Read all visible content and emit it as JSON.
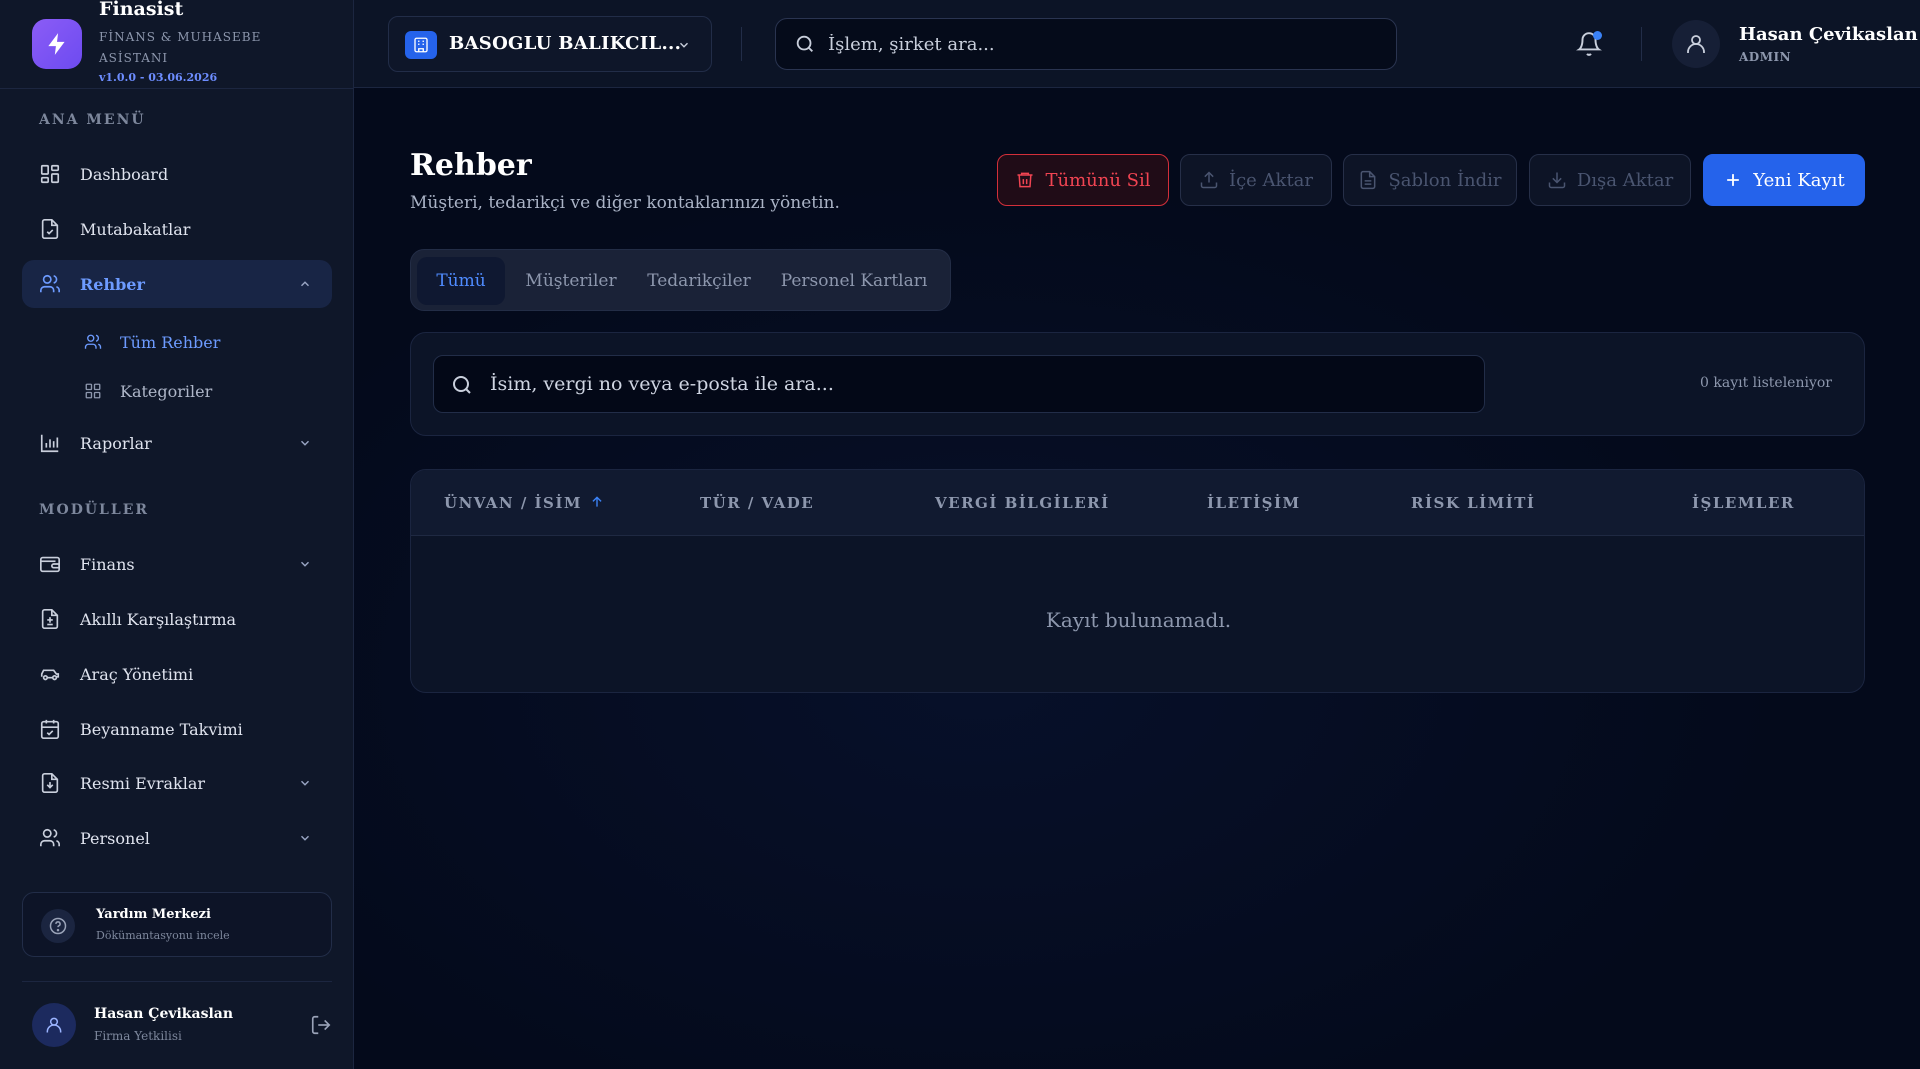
{
  "brand": {
    "name": "Finasist",
    "subtitle": "FİNANS & MUHASEBE ASİSTANI",
    "version": "v1.0.0 - 03.06.2026",
    "logo_icon": "lightning-icon",
    "accent": "#8b5cf6"
  },
  "sidebar": {
    "section_main": "ANA MENÜ",
    "section_modules": "MODÜLLER",
    "main_items": [
      {
        "label": "Dashboard",
        "icon": "dashboard-icon"
      },
      {
        "label": "Mutabakatlar",
        "icon": "document-check-icon"
      },
      {
        "label": "Rehber",
        "icon": "users-icon",
        "active": true,
        "expanded": true
      },
      {
        "label": "Raporlar",
        "icon": "bar-chart-icon"
      }
    ],
    "rehber_sub": [
      {
        "label": "Tüm Rehber",
        "icon": "users-icon",
        "active": true
      },
      {
        "label": "Kategoriler",
        "icon": "grid-icon"
      }
    ],
    "module_items": [
      {
        "label": "Finans",
        "icon": "wallet-icon"
      },
      {
        "label": "Akıllı Karşılaştırma",
        "icon": "file-diff-icon"
      },
      {
        "label": "Araç Yönetimi",
        "icon": "car-icon"
      },
      {
        "label": "Beyanname Takvimi",
        "icon": "calendar-check-icon"
      },
      {
        "label": "Resmi Evraklar",
        "icon": "file-download-icon"
      },
      {
        "label": "Personel",
        "icon": "users-icon"
      }
    ],
    "help": {
      "title": "Yardım Merkezi",
      "subtitle": "Dökümantasyonu incele",
      "icon": "help-circle-icon"
    },
    "user": {
      "name": "Hasan Çevikaslan",
      "role": "Firma Yetkilisi"
    }
  },
  "header": {
    "company": "BASOGLU BALIKCIL...",
    "search_placeholder": "İşlem, şirket ara...",
    "notification_dot_color": "#3b82f6",
    "user": {
      "name": "Hasan Çevikaslan",
      "role": "ADMIN"
    }
  },
  "page": {
    "title": "Rehber",
    "subtitle": "Müşteri, tedarikçi ve diğer kontaklarınızı yönetin.",
    "buttons": {
      "delete_all": "Tümünü Sil",
      "import": "İçe Aktar",
      "template": "Şablon İndir",
      "export": "Dışa Aktar",
      "new": "Yeni Kayıt"
    },
    "tabs": [
      "Tümü",
      "Müşteriler",
      "Tedarikçiler",
      "Personel Kartları"
    ],
    "active_tab": "Tümü",
    "search_placeholder": "İsim, vergi no veya e-posta ile ara...",
    "count_text": "0 kayıt listeleniyor",
    "table": {
      "columns": [
        "ÜNVAN / İSİM",
        "TÜR / VADE",
        "VERGİ BİLGİLERİ",
        "İLETİŞİM",
        "RİSK LİMİTİ",
        "İŞLEMLER"
      ],
      "empty_text": "Kayıt bulunamadı."
    }
  },
  "colors": {
    "primary": "#2563eb",
    "danger": "#f04452",
    "active_text": "#6d9bff"
  }
}
